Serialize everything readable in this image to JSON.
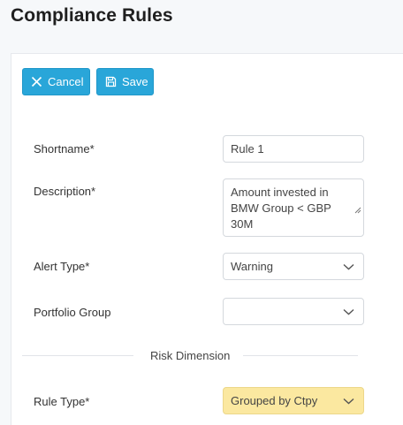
{
  "page": {
    "title": "Compliance Rules"
  },
  "toolbar": {
    "cancel_label": "Cancel",
    "save_label": "Save"
  },
  "form": {
    "shortname": {
      "label": "Shortname*",
      "value": "Rule 1"
    },
    "description": {
      "label": "Description*",
      "value": "Amount invested in BMW Group < GBP 30M"
    },
    "alert_type": {
      "label": "Alert Type*",
      "value": "Warning"
    },
    "portfolio_group": {
      "label": "Portfolio Group",
      "value": ""
    },
    "section": {
      "label": "Risk Dimension"
    },
    "rule_type": {
      "label": "Rule Type*",
      "value": "Grouped by Ctpy"
    }
  },
  "colors": {
    "accent": "#29a6d9",
    "highlight": "#fbe8a0"
  },
  "icons": {
    "cancel": "close-icon",
    "save": "save-icon",
    "dropdown": "chevron-down-icon"
  }
}
